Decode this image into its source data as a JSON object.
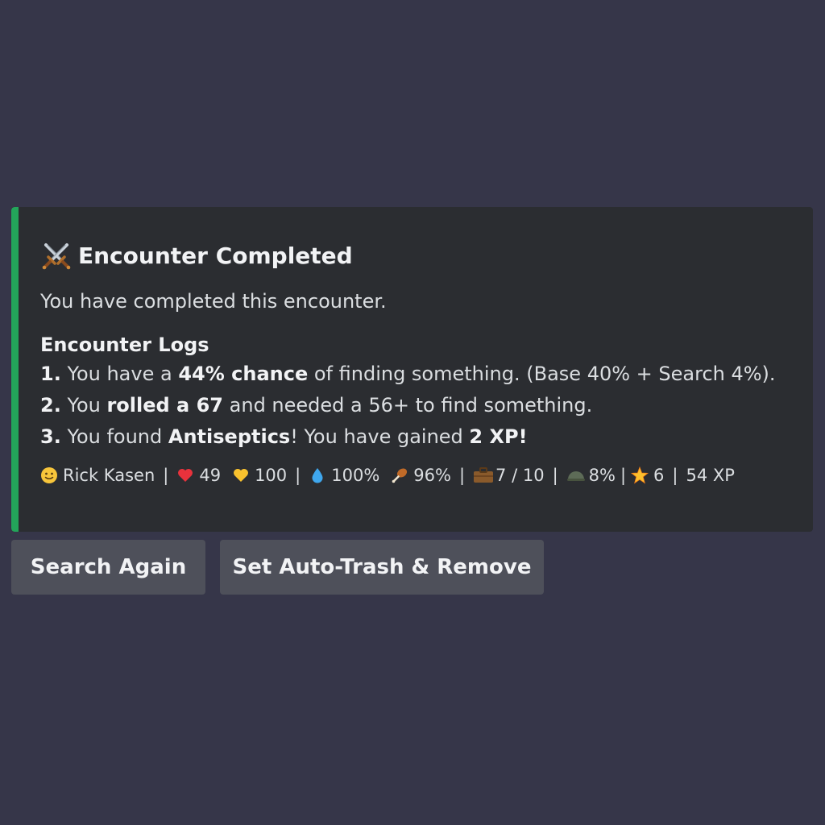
{
  "embed": {
    "accent_color": "#23a55a",
    "title_icon": "crossed-swords-icon",
    "title": "Encounter Completed",
    "description": "You have completed this encounter.",
    "logs_title": "Encounter Logs",
    "logs": [
      {
        "num": "1.",
        "p1": "You have a ",
        "b1": "44% chance",
        "p2": " of finding something. (Base 40% + Search 4%)."
      },
      {
        "num": "2.",
        "p1": "You ",
        "b1": "rolled a 67",
        "p2": " and needed a 56+ to find something."
      },
      {
        "num": "3.",
        "p1": "You found ",
        "b1": "Antiseptics",
        "p2": "! You have gained ",
        "b2": "2 XP!"
      }
    ],
    "stats": {
      "player_icon": "smiley-face-icon",
      "player_name": "Rick Kasen",
      "health_icon": "red-heart-icon",
      "health": "49",
      "stamina_icon": "yellow-heart-icon",
      "stamina": "100",
      "water_icon": "droplet-icon",
      "water": "100%",
      "food_icon": "drumstick-icon",
      "food": "96%",
      "inventory_icon": "briefcase-icon",
      "inventory": "7 / 10",
      "armor_icon": "helmet-icon",
      "armor": "8%",
      "level_icon": "star-icon",
      "level": "6",
      "xp": "54 XP",
      "separator": "|"
    }
  },
  "buttons": {
    "search_again": "Search Again",
    "auto_trash": "Set Auto-Trash & Remove"
  }
}
